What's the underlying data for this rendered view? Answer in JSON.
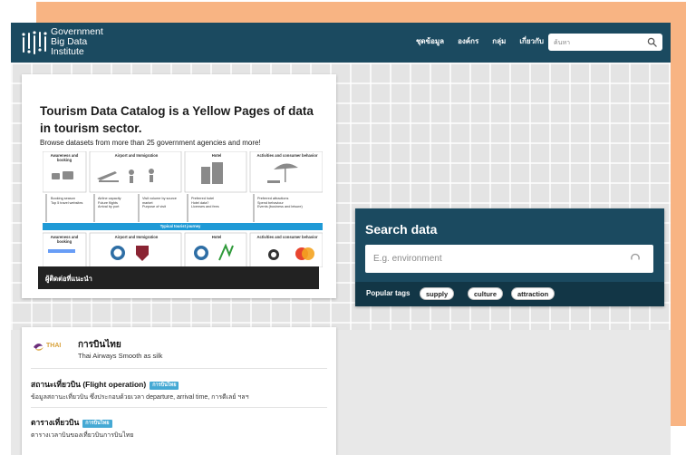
{
  "header": {
    "brand_lines": [
      "Government",
      "Big Data",
      "Institute"
    ],
    "nav": [
      "ชุดข้อมูล",
      "องค์กร",
      "กลุ่ม",
      "เกี่ยวกับ"
    ],
    "search_placeholder": "ค้นหา"
  },
  "catalog": {
    "title": "Tourism Data Catalog is a Yellow Pages of data in tourism sector.",
    "subtitle": "Browse datasets from more than 25 government agencies and more!",
    "journey": {
      "top_stages": [
        "Awareness and booking",
        "Airport and Immigration",
        "Hotel",
        "Activities and consumer behavior"
      ],
      "bottom_stages": [
        "Awareness and booking",
        "Airport and Immigration",
        "Hotel",
        "Activities and consumer behavior"
      ],
      "bullets": [
        [
          "Booking season",
          "Top 5 travel websites"
        ],
        [
          "Airline capacity",
          "Future flights",
          "Arrival by port"
        ],
        [
          "Visit volume by source market",
          "Purpose of visit"
        ],
        [
          "Preferred hotel",
          "Hotel data?",
          "Licenses and fees"
        ],
        [
          "Preferred attractions",
          "Spend behaviour",
          "Events (business and leisure)"
        ]
      ],
      "band_label": "Typical tourist journey",
      "caption": "ผู้ติดต่อที่แนะนำ"
    }
  },
  "search_panel": {
    "heading": "Search data",
    "placeholder": "E.g. environment",
    "tags_label": "Popular tags",
    "tags": [
      "supply",
      "culture",
      "attraction"
    ]
  },
  "datasets": {
    "org_logo_text": "THAI",
    "org_name": "การบินไทย",
    "org_tagline": "Thai Airways Smooth as silk",
    "items": [
      {
        "title": "สถานะเที่ยวบิน (Flight operation)",
        "badge": "การบินไทย",
        "desc": "ข้อมูลสถานะเที่ยวบิน ซึ่งประกอบด้วยเวลา departure, arrival time, การดีเลย์ ฯลฯ"
      },
      {
        "title": "ตารางเที่ยวบิน",
        "badge": "การบินไทย",
        "desc": "ตารางเวลาบินของเที่ยวบินการบินไทย"
      }
    ]
  },
  "colors": {
    "navbar": "#1b4a60",
    "tag_bar": "#123646",
    "badge": "#45a9d4",
    "backdrop": "#f8b483",
    "journey_band": "#1f9ad6"
  }
}
